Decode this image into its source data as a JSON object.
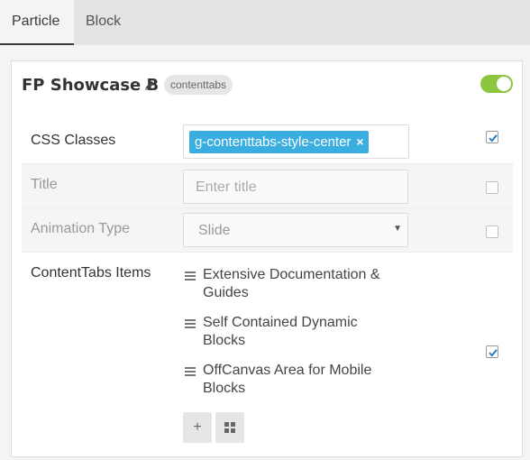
{
  "tabs": [
    {
      "label": "Particle",
      "active": true
    },
    {
      "label": "Block",
      "active": false
    }
  ],
  "card": {
    "title": "FP Showcase B",
    "tag": "contenttabs",
    "enabled": true
  },
  "fields": {
    "css_classes": {
      "label": "CSS Classes",
      "chip": "g-contenttabs-style-center",
      "chip_remove": "×",
      "checked": true
    },
    "title": {
      "label": "Title",
      "placeholder": "Enter title",
      "checked": false
    },
    "animation_type": {
      "label": "Animation Type",
      "value": "Slide",
      "checked": false
    },
    "contenttabs_items": {
      "label": "ContentTabs Items",
      "items": [
        "Extensive Documentation & Guides",
        "Self Contained Dynamic Blocks",
        "OffCanvas Area for Mobile Blocks"
      ],
      "checked": true,
      "add_label": "+",
      "grid_label": "▦"
    }
  },
  "colors": {
    "accent": "#3aaee0",
    "toggle_on": "#8cc63f"
  },
  "icons": [
    "pencil-icon",
    "drag-handle-icon",
    "plus-icon",
    "grid-icon",
    "checkmark-icon",
    "caret-down-icon"
  ]
}
